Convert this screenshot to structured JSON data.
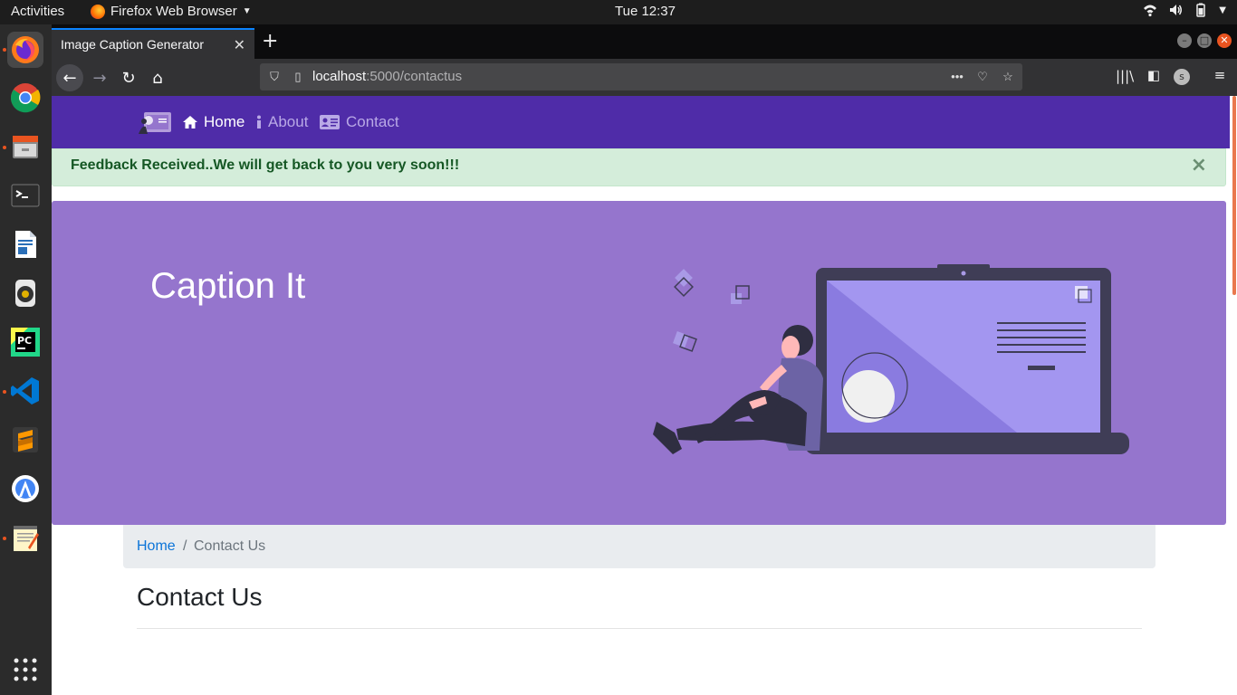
{
  "system": {
    "activities": "Activities",
    "app_name": "Firefox Web Browser",
    "clock": "Tue 12:37"
  },
  "dock": {
    "apps": [
      "firefox-icon",
      "chrome-icon",
      "files-icon",
      "terminal-icon",
      "writer-icon",
      "rhythmbox-icon",
      "pycharm-icon",
      "vscode-icon",
      "sublime-icon",
      "android-studio-icon",
      "text-editor-icon",
      "app-grid-icon"
    ]
  },
  "browser": {
    "tab_title": "Image Caption Generator",
    "url_host": "localhost",
    "url_path": ":5000/contactus",
    "accent": "#0a84ff"
  },
  "site": {
    "nav": {
      "home": "Home",
      "about": "About",
      "contact": "Contact",
      "color": "#4f2ca8"
    },
    "alert": {
      "message": "Feedback Received..We will get back to you very soon!!!",
      "close": "×"
    },
    "jumbotron": {
      "title": "Caption It",
      "color": "#9575cd"
    },
    "breadcrumb": {
      "home": "Home",
      "separator": "/",
      "current": "Contact Us"
    },
    "heading": "Contact Us"
  }
}
